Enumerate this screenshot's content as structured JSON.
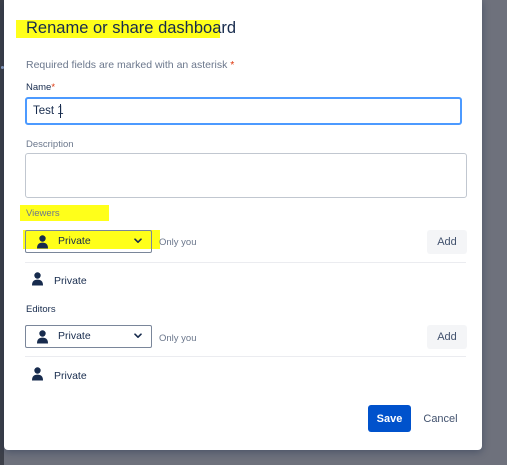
{
  "dialog": {
    "title": "Rename or share dashboard",
    "required_note": "Required fields are marked with an asterisk",
    "required_marker": "*"
  },
  "name_field": {
    "label": "Name",
    "value": "Test 1"
  },
  "description_field": {
    "label": "Description",
    "value": ""
  },
  "viewers": {
    "label": "Viewers",
    "selected": "Private",
    "hint": "Only you",
    "add_label": "Add",
    "entries": [
      {
        "icon": "person-icon",
        "label": "Private"
      }
    ]
  },
  "editors": {
    "label": "Editors",
    "selected": "Private",
    "hint": "Only you",
    "add_label": "Add",
    "entries": [
      {
        "icon": "person-icon",
        "label": "Private"
      }
    ]
  },
  "footer": {
    "save_label": "Save",
    "cancel_label": "Cancel"
  },
  "colors": {
    "primary": "#0052cc",
    "highlight": "#ffff1a",
    "focus_border": "#4c9aff",
    "text": "#172b4d",
    "subtle_text": "#6b778c",
    "required": "#de350b",
    "backdrop": "#6e717c"
  }
}
